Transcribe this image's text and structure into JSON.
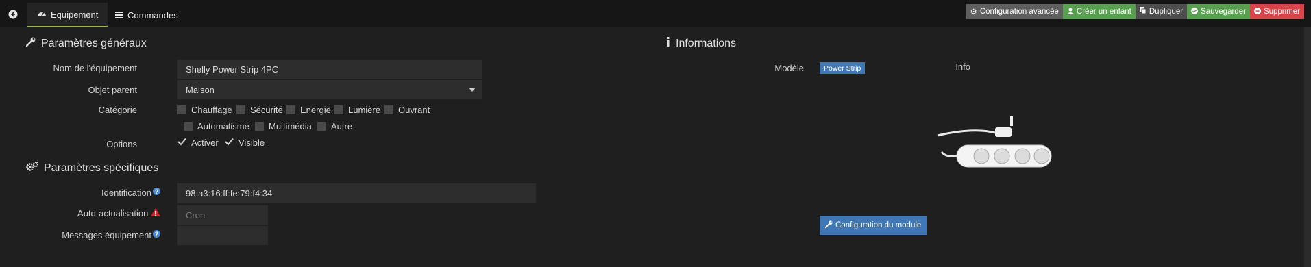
{
  "tabs": [
    {
      "label": "Equipement",
      "icon": "dashboard-icon"
    },
    {
      "label": "Commandes",
      "icon": "list-icon"
    }
  ],
  "actions": {
    "config_avancee": "Configuration avancée",
    "creer_enfant": "Créer un enfant",
    "dupliquer": "Dupliquer",
    "sauvegarder": "Sauvegarder",
    "supprimer": "Supprimer"
  },
  "general": {
    "title": "Paramètres généraux",
    "nom_label": "Nom de l'équipement",
    "nom_value": "Shelly Power Strip 4PC",
    "parent_label": "Objet parent",
    "parent_value": "Maison",
    "categorie_label": "Catégorie",
    "categories": [
      "Chauffage",
      "Sécurité",
      "Energie",
      "Lumière",
      "Ouvrant",
      "Automatisme",
      "Multimédia",
      "Autre"
    ],
    "options_label": "Options",
    "options": [
      "Activer",
      "Visible"
    ]
  },
  "specific": {
    "title": "Paramètres spécifiques",
    "identification_label": "Identification",
    "identification_value": "98:a3:16:ff:fe:79:f4:34",
    "autoactu_label": "Auto-actualisation",
    "autoactu_placeholder": "Cron",
    "messages_label": "Messages équipement"
  },
  "informations": {
    "title": "Informations",
    "modele_label": "Modèle",
    "modele_value": "Power Strip",
    "info_label": "Info",
    "config_module": "Configuration du module"
  },
  "colors": {
    "accent_tab": "#9ab744",
    "green": "#58a04f",
    "red": "#d9434a",
    "blue": "#3f78b5"
  }
}
